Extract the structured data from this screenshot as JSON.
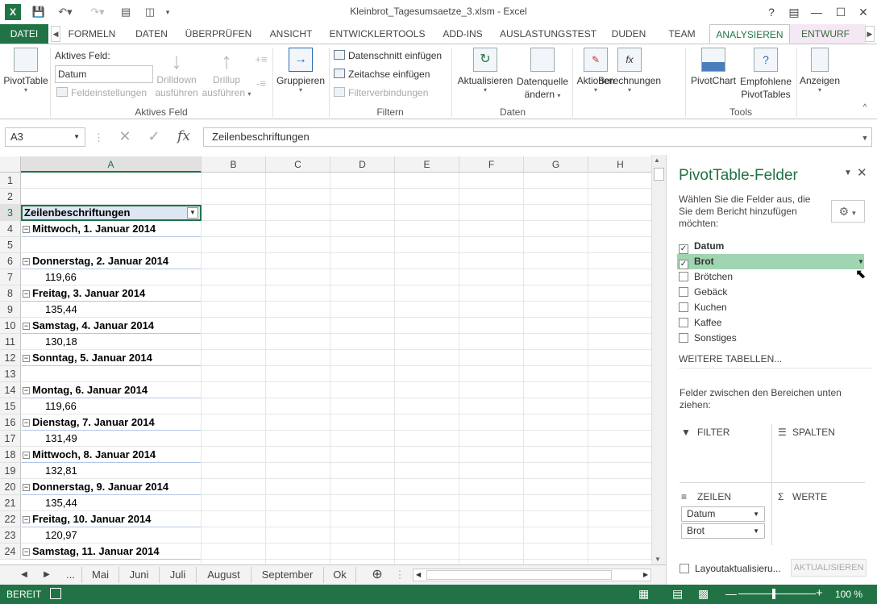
{
  "app": {
    "title": "Kleinbrot_Tagesumsaetze_3.xlsm - Excel",
    "logo": "X",
    "help": "?"
  },
  "tabs": [
    "DATEI",
    "FORMELN",
    "DATEN",
    "ÜBERPRÜFEN",
    "ANSICHT",
    "ENTWICKLERTOOLS",
    "ADD-INS",
    "AUSLASTUNGSTEST",
    "DUDEN",
    "TEAM",
    "ANALYSIEREN",
    "ENTWURF"
  ],
  "ribbon": {
    "pivottable": "PivotTable",
    "active_field_label": "Aktives Feld:",
    "active_field_value": "Datum",
    "field_settings": "Feldeinstellungen",
    "drilldown": [
      "Drilldown",
      "ausführen"
    ],
    "drillup": [
      "Drillup",
      "ausführen"
    ],
    "group_active_field": "Aktives Feld",
    "group": "Gruppieren",
    "insert_slicer": "Datenschnitt einfügen",
    "insert_timeline": "Zeitachse einfügen",
    "filter_connections": "Filterverbindungen",
    "group_filter": "Filtern",
    "refresh": "Aktualisieren",
    "change_source": [
      "Datenquelle",
      "ändern"
    ],
    "group_data": "Daten",
    "actions": "Aktionen",
    "calculations": "Berechnungen",
    "pivotchart": "PivotChart",
    "recommended": [
      "Empfohlene",
      "PivotTables"
    ],
    "group_tools": "Tools",
    "show": "Anzeigen"
  },
  "formula": {
    "namebox": "A3",
    "fx": "fx",
    "content": "Zeilenbeschriftungen"
  },
  "grid": {
    "columns": [
      "A",
      "B",
      "C",
      "D",
      "E",
      "F",
      "G",
      "H"
    ],
    "rows": [
      "1",
      "2",
      "3",
      "4",
      "5",
      "6",
      "7",
      "8",
      "9",
      "10",
      "11",
      "12",
      "13",
      "14",
      "15",
      "16",
      "17",
      "18",
      "19",
      "20",
      "21",
      "22",
      "23",
      "24"
    ],
    "header_cell": "Zeilenbeschriftungen",
    "pivot_rows": [
      {
        "row": 4,
        "text": "Mittwoch, 1. Januar 2014",
        "kind": "date"
      },
      {
        "row": 5,
        "text": "",
        "kind": "value"
      },
      {
        "row": 6,
        "text": "Donnerstag, 2. Januar 2014",
        "kind": "date"
      },
      {
        "row": 7,
        "text": "119,66",
        "kind": "value"
      },
      {
        "row": 8,
        "text": "Freitag, 3. Januar 2014",
        "kind": "date"
      },
      {
        "row": 9,
        "text": "135,44",
        "kind": "value"
      },
      {
        "row": 10,
        "text": "Samstag, 4. Januar 2014",
        "kind": "date"
      },
      {
        "row": 11,
        "text": "130,18",
        "kind": "value"
      },
      {
        "row": 12,
        "text": "Sonntag, 5. Januar 2014",
        "kind": "date"
      },
      {
        "row": 13,
        "text": "",
        "kind": "value"
      },
      {
        "row": 14,
        "text": "Montag, 6. Januar 2014",
        "kind": "date"
      },
      {
        "row": 15,
        "text": "119,66",
        "kind": "value"
      },
      {
        "row": 16,
        "text": "Dienstag, 7. Januar 2014",
        "kind": "date"
      },
      {
        "row": 17,
        "text": "131,49",
        "kind": "value"
      },
      {
        "row": 18,
        "text": "Mittwoch, 8. Januar 2014",
        "kind": "date"
      },
      {
        "row": 19,
        "text": "132,81",
        "kind": "value"
      },
      {
        "row": 20,
        "text": "Donnerstag, 9. Januar 2014",
        "kind": "date"
      },
      {
        "row": 21,
        "text": "135,44",
        "kind": "value"
      },
      {
        "row": 22,
        "text": "Freitag, 10. Januar 2014",
        "kind": "date"
      },
      {
        "row": 23,
        "text": "120,97",
        "kind": "value"
      },
      {
        "row": 24,
        "text": "Samstag, 11. Januar 2014",
        "kind": "date"
      }
    ]
  },
  "sheets": [
    "...",
    "Mai",
    "Juni",
    "Juli",
    "August",
    "September",
    "Ok"
  ],
  "pivot_pane": {
    "title": "PivotTable-Felder",
    "instruction": "Wählen Sie die Felder aus, die Sie dem Bericht hinzufügen möchten:",
    "fields": [
      {
        "name": "Datum",
        "checked": true
      },
      {
        "name": "Brot",
        "checked": true
      },
      {
        "name": "Brötchen",
        "checked": false
      },
      {
        "name": "Gebäck",
        "checked": false
      },
      {
        "name": "Kuchen",
        "checked": false
      },
      {
        "name": "Kaffee",
        "checked": false
      },
      {
        "name": "Sonstiges",
        "checked": false
      }
    ],
    "more_tables": "WEITERE TABELLEN...",
    "drag_hint": "Felder zwischen den Bereichen unten ziehen:",
    "filter": "FILTER",
    "columns": "SPALTEN",
    "rows": "ZEILEN",
    "values": "WERTE",
    "row_fields": [
      "Datum",
      "Brot"
    ],
    "defer_update": "Layoutaktualisieru...",
    "update_button": "AKTUALISIEREN"
  },
  "status": {
    "ready": "BEREIT",
    "zoom": "100 %"
  },
  "colors": {
    "accent": "#217346",
    "highlight": "#9fd5b0"
  }
}
